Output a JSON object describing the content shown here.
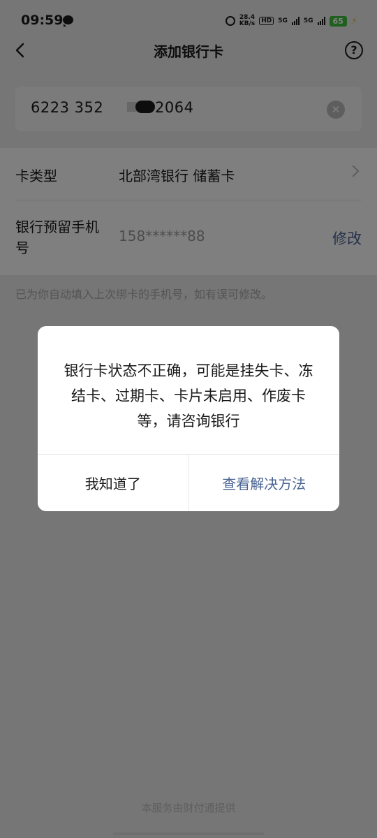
{
  "status_bar": {
    "time": "09:59",
    "net_speed_value": "28.4",
    "net_speed_unit": "KB/s",
    "hd_label": "HD",
    "sim1_label": "5G",
    "sim2_label": "5G",
    "battery": "65"
  },
  "nav": {
    "title": "添加银行卡",
    "help_glyph": "?"
  },
  "card_input": {
    "left_part": "6223 352",
    "right_part": "2064"
  },
  "form": {
    "card_type": {
      "label": "卡类型",
      "value": "北部湾银行 储蓄卡"
    },
    "phone": {
      "label": "银行预留手机号",
      "value": "158******88",
      "modify_label": "修改"
    }
  },
  "hint": "已为你自动填入上次绑卡的手机号，如有误可修改。",
  "dialog": {
    "message": "银行卡状态不正确，可能是挂失卡、冻结卡、过期卡、卡片未启用、作废卡等，请咨询银行",
    "ok_label": "我知道了",
    "solution_label": "查看解决方法"
  },
  "footer": "本服务由财付通提供",
  "colors": {
    "link": "#4a6494",
    "battery": "#3ec03e"
  }
}
